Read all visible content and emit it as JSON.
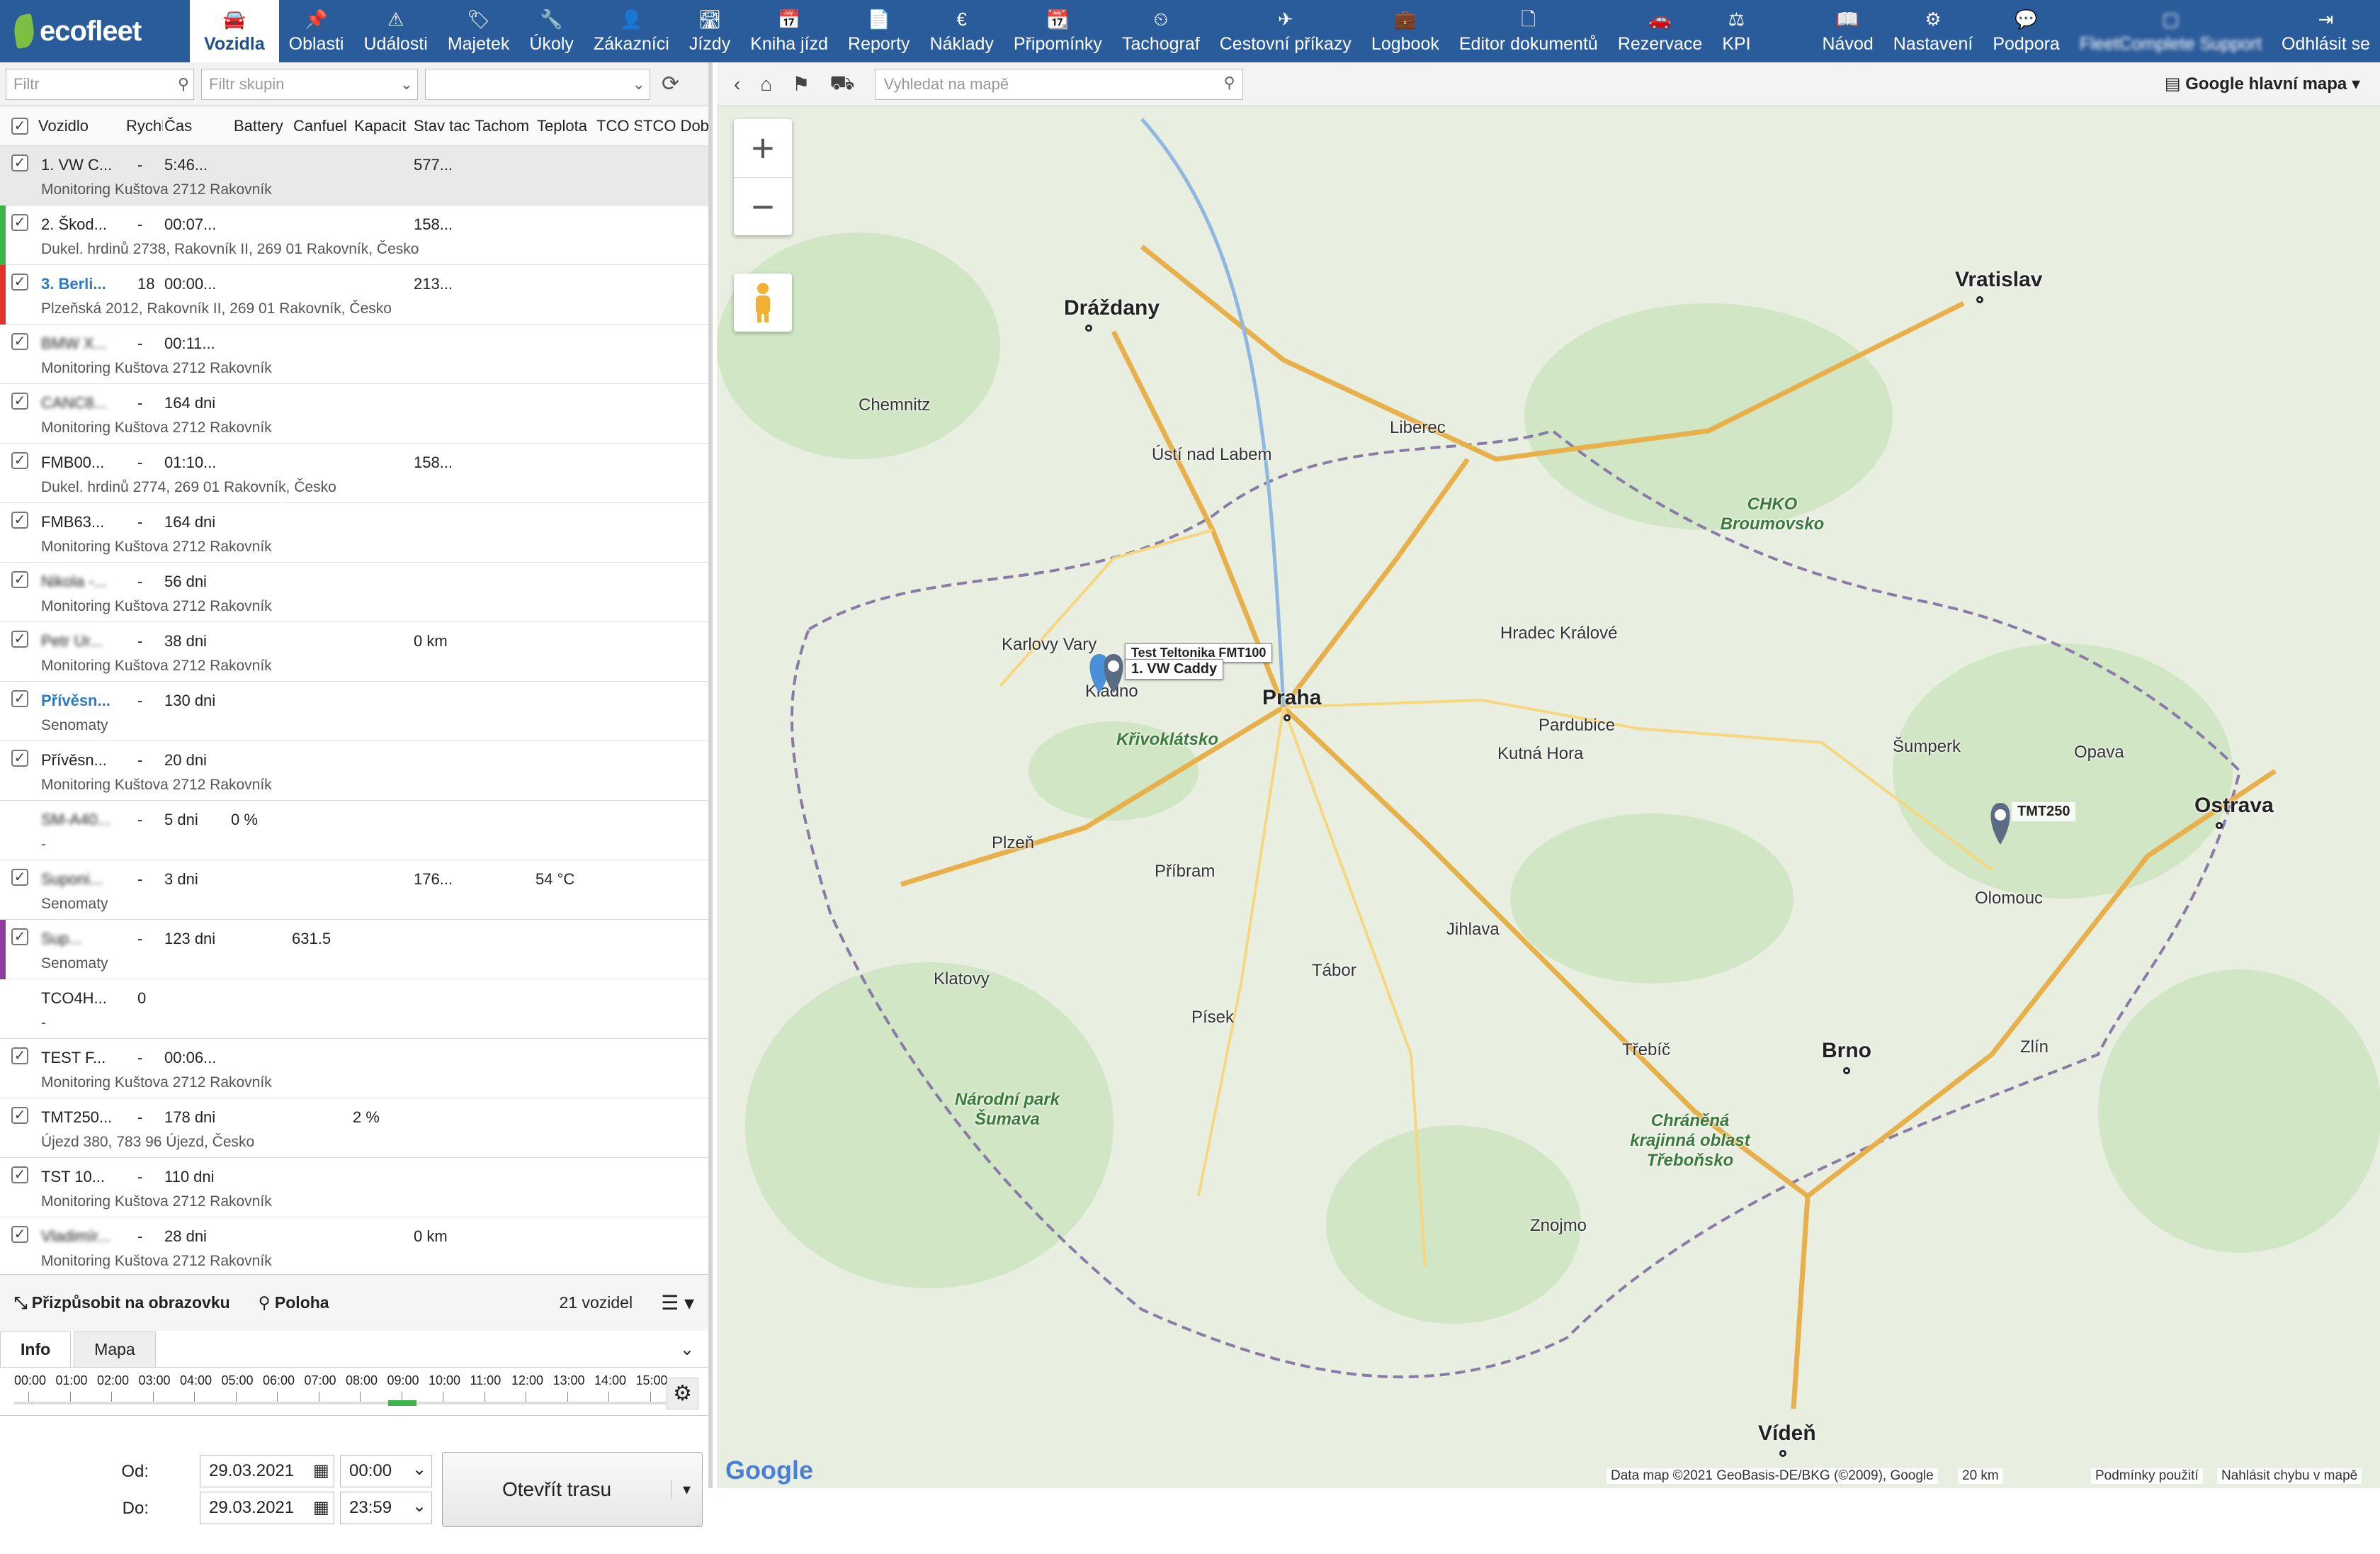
{
  "brand": {
    "name": "ecofleet"
  },
  "nav": {
    "items": [
      {
        "label": "Vozidla",
        "icon": "car-icon",
        "glyph": "🚘",
        "active": true
      },
      {
        "label": "Oblasti",
        "icon": "pin-icon",
        "glyph": "📌"
      },
      {
        "label": "Události",
        "icon": "warning-icon",
        "glyph": "⚠"
      },
      {
        "label": "Majetek",
        "icon": "tag-icon",
        "glyph": "🏷"
      },
      {
        "label": "Úkoly",
        "icon": "wrench-icon",
        "glyph": "🔧"
      },
      {
        "label": "Zákazníci",
        "icon": "person-icon",
        "glyph": "👤"
      },
      {
        "label": "Jízdy",
        "icon": "road-icon",
        "glyph": "🛣"
      },
      {
        "label": "Kniha jízd",
        "icon": "calendar-icon",
        "glyph": "📅"
      },
      {
        "label": "Reporty",
        "icon": "document-icon",
        "glyph": "📄"
      },
      {
        "label": "Náklady",
        "icon": "euro-icon",
        "glyph": "€"
      },
      {
        "label": "Připomínky",
        "icon": "calendar-check-icon",
        "glyph": "📆"
      },
      {
        "label": "Tachograf",
        "icon": "gauge-icon",
        "glyph": "⏲"
      },
      {
        "label": "Cestovní příkazy",
        "icon": "plane-icon",
        "glyph": "✈"
      },
      {
        "label": "Logbook",
        "icon": "briefcase-icon",
        "glyph": "💼"
      },
      {
        "label": "Editor dokumentů",
        "icon": "file-icon",
        "glyph": "🗋"
      },
      {
        "label": "Rezervace",
        "icon": "car-front-icon",
        "glyph": "🚗"
      },
      {
        "label": "KPI",
        "icon": "scales-icon",
        "glyph": "⚖"
      }
    ],
    "right_items": [
      {
        "label": "Návod",
        "icon": "book-icon",
        "glyph": "📖"
      },
      {
        "label": "Nastavení",
        "icon": "gears-icon",
        "glyph": "⚙"
      },
      {
        "label": "Podpora",
        "icon": "chat-icon",
        "glyph": "💬"
      },
      {
        "label": "FleetComplete Support",
        "icon": "user-icon",
        "glyph": "▢"
      },
      {
        "label": "Odhlásit se",
        "icon": "logout-icon",
        "glyph": "⇥"
      }
    ]
  },
  "filters": {
    "filter_placeholder": "Filtr",
    "group_placeholder": "Filtr skupin"
  },
  "columns": [
    "Vozidlo",
    "Rychl",
    "Čas",
    "Battery",
    "Canfuel",
    "Kapacit",
    "Stav tac",
    "Tachom",
    "Teplota",
    "TCO S",
    "TCO Dob"
  ],
  "vehicles": [
    {
      "name": "1. VW C...",
      "speed": "-",
      "time": "5:46...",
      "tach": "577...",
      "addr": "Monitoring Kuštova 2712 Rakovník",
      "marker": "",
      "selected": true
    },
    {
      "name": "2. Škod...",
      "speed": "-",
      "time": "00:07...",
      "tach": "158...",
      "addr": "Dukel. hrdinů 2738, Rakovník II, 269 01 Rakovník, Česko",
      "marker": "#3bb54a"
    },
    {
      "name": "3. Berli...",
      "speed": "18",
      "time": "00:00...",
      "tach": "213...",
      "addr": "Plzeňská 2012, Rakovník II, 269 01 Rakovník, Česko",
      "marker": "#e0352b",
      "link": true
    },
    {
      "name": "BMW X...",
      "speed": "-",
      "time": "00:11...",
      "addr": "Monitoring Kuštova 2712 Rakovník",
      "blur": true
    },
    {
      "name": "CANC8...",
      "speed": "-",
      "time": "164 dni",
      "addr": "Monitoring Kuštova 2712 Rakovník",
      "blur": true
    },
    {
      "name": "FMB00...",
      "speed": "-",
      "time": "01:10...",
      "tach": "158...",
      "addr": "Dukel. hrdinů 2774, 269 01 Rakovník, Česko"
    },
    {
      "name": "FMB63...",
      "speed": "-",
      "time": "164 dni",
      "addr": "Monitoring Kuštova 2712 Rakovník"
    },
    {
      "name": "Nikola -...",
      "speed": "-",
      "time": "56 dni",
      "addr": "Monitoring Kuštova 2712 Rakovník",
      "blur": true
    },
    {
      "name": "Petr Ur...",
      "speed": "-",
      "time": "38 dni",
      "tach": "0 km",
      "addr": "Monitoring Kuštova 2712 Rakovník",
      "blur": true
    },
    {
      "name": "Přívěsn...",
      "speed": "-",
      "time": "130 dni",
      "addr": "Senomaty",
      "link": true
    },
    {
      "name": "Přívěsn...",
      "speed": "-",
      "time": "20 dni",
      "addr": "Monitoring Kuštova 2712 Rakovník"
    },
    {
      "name": "SM-A40...",
      "speed": "-",
      "time": "5 dni",
      "batt": "0 %",
      "addr": "-",
      "blur": true,
      "nocheck": true
    },
    {
      "name": "Suponi...",
      "speed": "-",
      "time": "3 dni",
      "tach": "176...",
      "temp": "54 °C",
      "addr": "Senomaty",
      "blur": true
    },
    {
      "name": "Sup...",
      "speed": "-",
      "time": "123 dni",
      "canfuel": "631.5",
      "addr": "Senomaty",
      "marker": "#8e3d9e",
      "blur": true
    },
    {
      "name": "TCO4H...",
      "speed": "0",
      "time": "",
      "addr": "-",
      "nocheck": true
    },
    {
      "name": "TEST F...",
      "speed": "-",
      "time": "00:06...",
      "addr": "Monitoring Kuštova 2712 Rakovník"
    },
    {
      "name": "TMT250...",
      "speed": "-",
      "time": "178 dni",
      "kapacit": "2 %",
      "addr": "Újezd 380, 783 96 Újezd, Česko"
    },
    {
      "name": "TST 10...",
      "speed": "-",
      "time": "110 dni",
      "addr": "Monitoring Kuštova 2712 Rakovník"
    },
    {
      "name": "Vladimír...",
      "speed": "-",
      "time": "28 dni",
      "tach": "0 km",
      "addr": "Monitoring Kuštova 2712 Rakovník",
      "blur": true
    }
  ],
  "footer": {
    "fit_label": "Přizpůsobit na obrazovku",
    "position_label": "Poloha",
    "count_label": "21 vozidel"
  },
  "bottom_tabs": [
    "Info",
    "Mapa"
  ],
  "timeline": {
    "ticks": [
      "00:00",
      "01:00",
      "02:00",
      "03:00",
      "04:00",
      "05:00",
      "06:00",
      "07:00",
      "08:00",
      "09:00",
      "10:00",
      "11:00",
      "12:00",
      "13:00",
      "14:00",
      "15:00"
    ]
  },
  "route": {
    "from_label": "Od:",
    "to_label": "Do:",
    "from_date": "29.03.2021",
    "from_time": "00:00",
    "to_date": "29.03.2021",
    "to_time": "23:59",
    "open_button": "Otevřít trasu"
  },
  "map": {
    "search_placeholder": "Vyhledat na mapě",
    "type_label": "Google hlavní mapa",
    "attribution": "Data map ©2021 GeoBasis-DE/BKG (©2009), Google",
    "scale": "20 km",
    "terms": "Podmínky použití",
    "report": "Nahlásit chybu v mapě",
    "google_logo": "Google",
    "vehicle_labels": [
      "1. VW Caddy",
      "Test Teltonika FMT100",
      "TMT250"
    ],
    "cities": [
      {
        "name": "Dráždany",
        "big": true
      },
      {
        "name": "Praha",
        "big": true
      },
      {
        "name": "Vratislav",
        "big": true
      },
      {
        "name": "Brno",
        "big": true
      },
      {
        "name": "Ostrava",
        "big": true
      },
      {
        "name": "Vídeň",
        "big": true
      },
      {
        "name": "Plzeň"
      },
      {
        "name": "Liberec"
      },
      {
        "name": "Pardubice"
      },
      {
        "name": "Olomouc"
      },
      {
        "name": "Chemnitz"
      },
      {
        "name": "Jihlava"
      },
      {
        "name": "Zlín"
      },
      {
        "name": "Tábor"
      },
      {
        "name": "Kladno"
      },
      {
        "name": "Ústí nad Labem"
      },
      {
        "name": "Hradec Králové"
      },
      {
        "name": "Karlovy Vary"
      },
      {
        "name": "Kutná Hora"
      },
      {
        "name": "Příbram"
      },
      {
        "name": "Klatovy"
      },
      {
        "name": "Písek"
      },
      {
        "name": "Znojmo"
      },
      {
        "name": "Třebíč"
      },
      {
        "name": "Opava"
      },
      {
        "name": "Šumperk"
      },
      {
        "name": "Křivoklátsko",
        "green": true
      },
      {
        "name": "CHKO Broumovsko",
        "green": true
      },
      {
        "name": "Chráněná krajinná oblast Třeboňsko",
        "green": true
      },
      {
        "name": "Národní park Šumava",
        "green": true
      }
    ]
  },
  "colors": {
    "nav_bg": "#2a5b9a",
    "accent": "#2e7bc4"
  }
}
